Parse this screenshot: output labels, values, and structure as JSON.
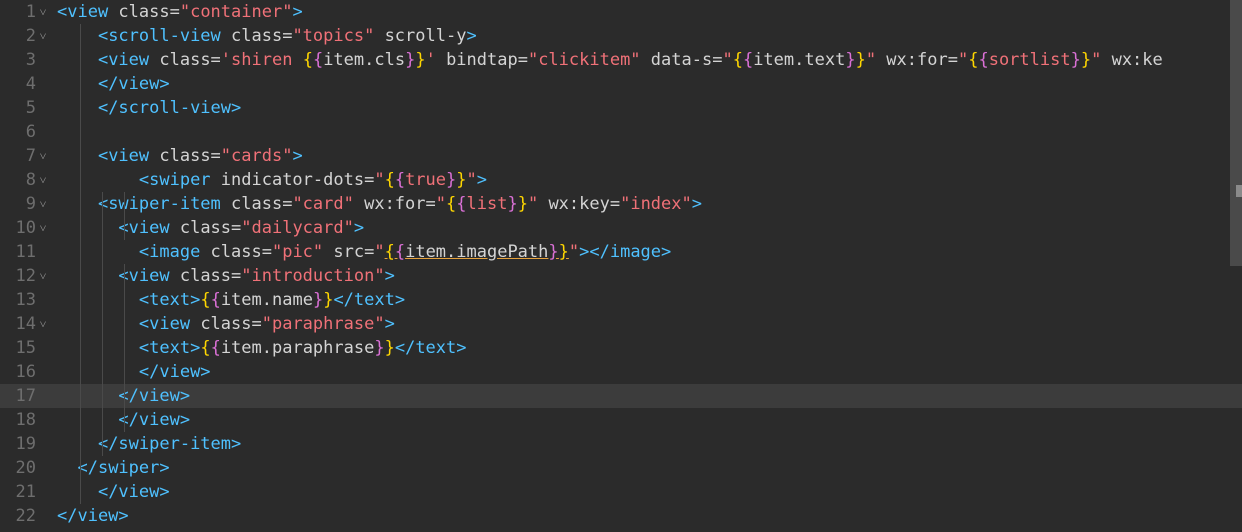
{
  "editor": {
    "active_line": 17,
    "lines": [
      {
        "num": "1",
        "fold": true,
        "tokens": [
          [
            "tag",
            "<view"
          ],
          [
            "attr",
            " class="
          ],
          [
            "str",
            "\"container\""
          ],
          [
            "tag",
            ">"
          ]
        ]
      },
      {
        "num": "2",
        "fold": true,
        "tokens": [
          [
            "attr",
            "    "
          ],
          [
            "tag",
            "<scroll-view"
          ],
          [
            "attr",
            " class="
          ],
          [
            "str",
            "\"topics\""
          ],
          [
            "attr",
            " scroll-y"
          ],
          [
            "tag",
            ">"
          ]
        ]
      },
      {
        "num": "3",
        "fold": false,
        "tokens": [
          [
            "attr",
            "    "
          ],
          [
            "tag",
            "<view"
          ],
          [
            "attr",
            " class="
          ],
          [
            "str",
            "'shiren "
          ],
          [
            "brace",
            "{"
          ],
          [
            "brace2",
            "{"
          ],
          [
            "expr",
            "item.cls"
          ],
          [
            "brace2",
            "}"
          ],
          [
            "brace",
            "}"
          ],
          [
            "str",
            "'"
          ],
          [
            "attr",
            " bindtap="
          ],
          [
            "str",
            "\"clickitem\""
          ],
          [
            "attr",
            " data-s="
          ],
          [
            "str",
            "\""
          ],
          [
            "brace",
            "{"
          ],
          [
            "brace2",
            "{"
          ],
          [
            "expr",
            "item.text"
          ],
          [
            "brace2",
            "}"
          ],
          [
            "brace",
            "}"
          ],
          [
            "str",
            "\""
          ],
          [
            "attr",
            " wx:for="
          ],
          [
            "str",
            "\""
          ],
          [
            "brace",
            "{"
          ],
          [
            "brace2",
            "{"
          ],
          [
            "str",
            "sortlist"
          ],
          [
            "brace2",
            "}"
          ],
          [
            "brace",
            "}"
          ],
          [
            "str",
            "\""
          ],
          [
            "attr",
            " wx:ke"
          ]
        ]
      },
      {
        "num": "4",
        "fold": false,
        "tokens": [
          [
            "attr",
            "    "
          ],
          [
            "tag",
            "</view>"
          ]
        ]
      },
      {
        "num": "5",
        "fold": false,
        "tokens": [
          [
            "attr",
            "    "
          ],
          [
            "tag",
            "</scroll-view>"
          ]
        ]
      },
      {
        "num": "6",
        "fold": false,
        "tokens": []
      },
      {
        "num": "7",
        "fold": true,
        "tokens": [
          [
            "attr",
            "    "
          ],
          [
            "tag",
            "<view"
          ],
          [
            "attr",
            " class="
          ],
          [
            "str",
            "\"cards\""
          ],
          [
            "tag",
            ">"
          ]
        ]
      },
      {
        "num": "8",
        "fold": true,
        "tokens": [
          [
            "attr",
            "        "
          ],
          [
            "tag",
            "<swiper"
          ],
          [
            "attr",
            " indicator-dots="
          ],
          [
            "str",
            "\""
          ],
          [
            "brace",
            "{"
          ],
          [
            "brace2",
            "{"
          ],
          [
            "str",
            "true"
          ],
          [
            "brace2",
            "}"
          ],
          [
            "brace",
            "}"
          ],
          [
            "str",
            "\""
          ],
          [
            "tag",
            ">"
          ]
        ]
      },
      {
        "num": "9",
        "fold": true,
        "tokens": [
          [
            "attr",
            "    "
          ],
          [
            "tag",
            "<swiper-item"
          ],
          [
            "attr",
            " class="
          ],
          [
            "str",
            "\"card\""
          ],
          [
            "attr",
            " wx:for="
          ],
          [
            "str",
            "\""
          ],
          [
            "brace",
            "{"
          ],
          [
            "brace2",
            "{"
          ],
          [
            "str",
            "list"
          ],
          [
            "brace2",
            "}"
          ],
          [
            "brace",
            "}"
          ],
          [
            "str",
            "\""
          ],
          [
            "attr",
            " wx:key="
          ],
          [
            "str",
            "\"index\""
          ],
          [
            "tag",
            ">"
          ]
        ]
      },
      {
        "num": "10",
        "fold": true,
        "tokens": [
          [
            "attr",
            "      "
          ],
          [
            "tag",
            "<view"
          ],
          [
            "attr",
            " class="
          ],
          [
            "str",
            "\"dailycard\""
          ],
          [
            "tag",
            ">"
          ]
        ]
      },
      {
        "num": "11",
        "fold": false,
        "tokens": [
          [
            "attr",
            "        "
          ],
          [
            "tag",
            "<image"
          ],
          [
            "attr",
            " class="
          ],
          [
            "str",
            "\"pic\""
          ],
          [
            "attr",
            " src="
          ],
          [
            "str",
            "\""
          ],
          [
            "brace",
            "{"
          ],
          [
            "brace2",
            "{"
          ],
          [
            "expr",
            "item.imagePath"
          ],
          [
            "brace2",
            "}"
          ],
          [
            "brace",
            "}"
          ],
          [
            "str",
            "\""
          ],
          [
            "tag",
            "></image>"
          ]
        ]
      },
      {
        "num": "12",
        "fold": true,
        "tokens": [
          [
            "attr",
            "      "
          ],
          [
            "tag",
            "<view"
          ],
          [
            "attr",
            " class="
          ],
          [
            "str",
            "\"introduction\""
          ],
          [
            "tag",
            ">"
          ]
        ]
      },
      {
        "num": "13",
        "fold": false,
        "tokens": [
          [
            "attr",
            "        "
          ],
          [
            "tag",
            "<text>"
          ],
          [
            "brace",
            "{"
          ],
          [
            "brace2",
            "{"
          ],
          [
            "expr",
            "item.name"
          ],
          [
            "brace2",
            "}"
          ],
          [
            "brace",
            "}"
          ],
          [
            "tag",
            "</text>"
          ]
        ]
      },
      {
        "num": "14",
        "fold": true,
        "tokens": [
          [
            "attr",
            "        "
          ],
          [
            "tag",
            "<view"
          ],
          [
            "attr",
            " class="
          ],
          [
            "str",
            "\"paraphrase\""
          ],
          [
            "tag",
            ">"
          ]
        ]
      },
      {
        "num": "15",
        "fold": false,
        "tokens": [
          [
            "attr",
            "        "
          ],
          [
            "tag",
            "<text>"
          ],
          [
            "brace",
            "{"
          ],
          [
            "brace2",
            "{"
          ],
          [
            "expr",
            "item.paraphrase"
          ],
          [
            "brace2",
            "}"
          ],
          [
            "brace",
            "}"
          ],
          [
            "tag",
            "</text>"
          ]
        ]
      },
      {
        "num": "16",
        "fold": false,
        "tokens": [
          [
            "attr",
            "        "
          ],
          [
            "tag",
            "</view>"
          ]
        ]
      },
      {
        "num": "17",
        "fold": false,
        "tokens": [
          [
            "attr",
            "      "
          ],
          [
            "tag",
            "</view>"
          ]
        ]
      },
      {
        "num": "18",
        "fold": false,
        "tokens": [
          [
            "attr",
            "      "
          ],
          [
            "tag",
            "</view>"
          ]
        ]
      },
      {
        "num": "19",
        "fold": false,
        "tokens": [
          [
            "attr",
            "    "
          ],
          [
            "tag",
            "</swiper-item>"
          ]
        ]
      },
      {
        "num": "20",
        "fold": false,
        "tokens": [
          [
            "attr",
            "  "
          ],
          [
            "tag",
            "</swiper>"
          ]
        ]
      },
      {
        "num": "21",
        "fold": false,
        "tokens": [
          [
            "attr",
            "    "
          ],
          [
            "tag",
            "</view>"
          ]
        ]
      },
      {
        "num": "22",
        "fold": false,
        "tokens": [
          [
            "tag",
            "</view>"
          ]
        ]
      }
    ]
  }
}
